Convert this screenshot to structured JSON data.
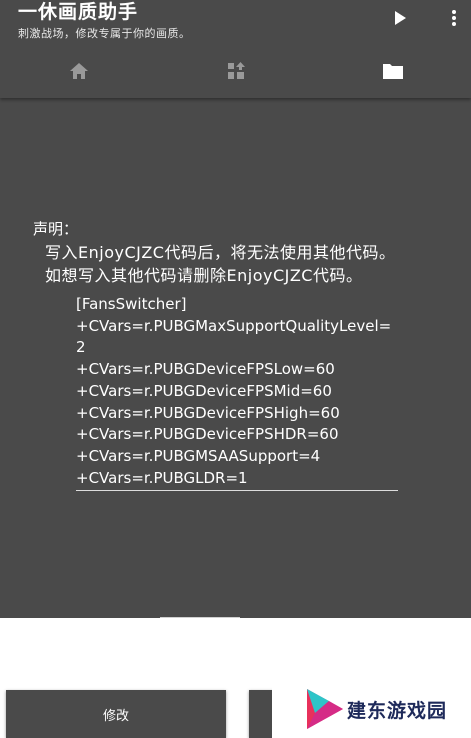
{
  "app": {
    "title": "一休画质助手",
    "subtitle": "刺激战场，修改专属于你的画质。"
  },
  "toolbar": {
    "play_icon": "play-icon",
    "more_icon": "more-vert-icon"
  },
  "tabs": [
    {
      "icon": "home-icon",
      "selected": false
    },
    {
      "icon": "upgrade-icon",
      "selected": false
    },
    {
      "icon": "folder-icon",
      "selected": true
    }
  ],
  "notice": {
    "label": "声明：",
    "line1": "写入EnjoyCJZC代码后，将无法使用其他代码。",
    "line2": "如想写入其他代码请删除EnjoyCJZC代码。"
  },
  "code_lines": [
    "[FansSwitcher]",
    "+CVars=r.PUBGMaxSupportQualityLevel=",
    "2",
    "+CVars=r.PUBGDeviceFPSLow=60",
    "+CVars=r.PUBGDeviceFPSMid=60",
    "+CVars=r.PUBGDeviceFPSHigh=60",
    "+CVars=r.PUBGDeviceFPSHDR=60",
    "+CVars=r.PUBGMSAASupport=4",
    "+CVars=r.PUBGLDR=1"
  ],
  "buttons": {
    "modify_label": "修改"
  },
  "watermark": {
    "text": "建东游戏园"
  },
  "colors": {
    "surface": "#4a4a4a",
    "text": "#ffffff",
    "watermark_text": "#1e2a5a"
  }
}
